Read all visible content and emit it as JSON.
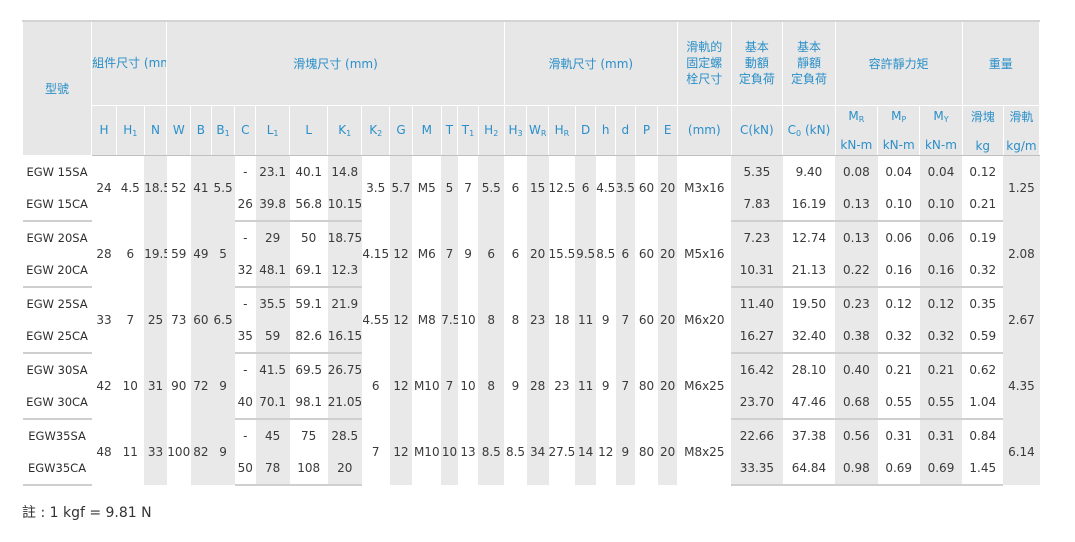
{
  "headers": {
    "model": "型號",
    "assembly": "組件尺寸 (mm)",
    "block": "滑塊尺寸 (mm)",
    "rail": "滑軌尺寸 (mm)",
    "bolt_l1": "滑軌的",
    "bolt_l2": "固定螺",
    "bolt_l3": "栓尺寸",
    "dyn_l1": "基本",
    "dyn_l2": "動額",
    "dyn_l3": "定負荷",
    "sta_l1": "基本",
    "sta_l2": "靜額",
    "sta_l3": "定負荷",
    "moment": "容許靜力矩",
    "weight": "重量",
    "block_w": "滑塊",
    "rail_w": "滑軌",
    "mm": "(mm)",
    "c_kn": "C(kN)",
    "c0_kn": "C",
    "c0_sub": "0",
    "c0_unit": " (kN)",
    "knm1": "kN-m",
    "knm2": "kN-m",
    "knm3": "kN-m",
    "kg": "kg",
    "kgm": "kg/m"
  },
  "subheaders": [
    {
      "t": "H",
      "s": ""
    },
    {
      "t": "H",
      "s": "1"
    },
    {
      "t": "N",
      "s": ""
    },
    {
      "t": "W",
      "s": ""
    },
    {
      "t": "B",
      "s": ""
    },
    {
      "t": "B",
      "s": "1"
    },
    {
      "t": "C",
      "s": ""
    },
    {
      "t": "L",
      "s": "1"
    },
    {
      "t": "L",
      "s": ""
    },
    {
      "t": "K",
      "s": "1"
    },
    {
      "t": "K",
      "s": "2"
    },
    {
      "t": "G",
      "s": ""
    },
    {
      "t": "M",
      "s": ""
    },
    {
      "t": "T",
      "s": ""
    },
    {
      "t": "T",
      "s": "1"
    },
    {
      "t": "H",
      "s": "2"
    },
    {
      "t": "H",
      "s": "3"
    },
    {
      "t": "W",
      "s": "R"
    },
    {
      "t": "H",
      "s": "R"
    },
    {
      "t": "D",
      "s": ""
    },
    {
      "t": "h",
      "s": ""
    },
    {
      "t": "d",
      "s": ""
    },
    {
      "t": "P",
      "s": ""
    },
    {
      "t": "E",
      "s": ""
    }
  ],
  "moments": [
    {
      "t": "M",
      "s": "R"
    },
    {
      "t": "M",
      "s": "P"
    },
    {
      "t": "M",
      "s": "Y"
    }
  ],
  "groups": [
    {
      "common": {
        "H": "24",
        "H1": "4.5",
        "N": "18.5",
        "W": "52",
        "B": "41",
        "B1": "5.5",
        "K2": "3.5",
        "G": "5.7",
        "M": "M5",
        "T": "5",
        "T1": "7",
        "H2": "5.5",
        "H3": "6",
        "WR": "15",
        "HR": "12.5",
        "D": "6",
        "h": "4.5",
        "d": "3.5",
        "P": "60",
        "E": "20",
        "bolt": "M3x16",
        "rail_w": "1.25"
      },
      "rows": [
        {
          "model": "EGW 15SA",
          "C": "-",
          "L1": "23.1",
          "L": "40.1",
          "K1": "14.8",
          "dyn": "5.35",
          "sta": "9.40",
          "MR": "0.08",
          "MP": "0.04",
          "MY": "0.04",
          "block_w": "0.12"
        },
        {
          "model": "EGW 15CA",
          "C": "26",
          "L1": "39.8",
          "L": "56.8",
          "K1": "10.15",
          "dyn": "7.83",
          "sta": "16.19",
          "MR": "0.13",
          "MP": "0.10",
          "MY": "0.10",
          "block_w": "0.21"
        }
      ]
    },
    {
      "common": {
        "H": "28",
        "H1": "6",
        "N": "19.5",
        "W": "59",
        "B": "49",
        "B1": "5",
        "K2": "4.15",
        "G": "12",
        "M": "M6",
        "T": "7",
        "T1": "9",
        "H2": "6",
        "H3": "6",
        "WR": "20",
        "HR": "15.5",
        "D": "9.5",
        "h": "8.5",
        "d": "6",
        "P": "60",
        "E": "20",
        "bolt": "M5x16",
        "rail_w": "2.08"
      },
      "rows": [
        {
          "model": "EGW 20SA",
          "C": "-",
          "L1": "29",
          "L": "50",
          "K1": "18.75",
          "dyn": "7.23",
          "sta": "12.74",
          "MR": "0.13",
          "MP": "0.06",
          "MY": "0.06",
          "block_w": "0.19"
        },
        {
          "model": "EGW 20CA",
          "C": "32",
          "L1": "48.1",
          "L": "69.1",
          "K1": "12.3",
          "dyn": "10.31",
          "sta": "21.13",
          "MR": "0.22",
          "MP": "0.16",
          "MY": "0.16",
          "block_w": "0.32"
        }
      ]
    },
    {
      "common": {
        "H": "33",
        "H1": "7",
        "N": "25",
        "W": "73",
        "B": "60",
        "B1": "6.5",
        "K2": "4.55",
        "G": "12",
        "M": "M8",
        "T": "7.5",
        "T1": "10",
        "H2": "8",
        "H3": "8",
        "WR": "23",
        "HR": "18",
        "D": "11",
        "h": "9",
        "d": "7",
        "P": "60",
        "E": "20",
        "bolt": "M6x20",
        "rail_w": "2.67"
      },
      "rows": [
        {
          "model": "EGW 25SA",
          "C": "-",
          "L1": "35.5",
          "L": "59.1",
          "K1": "21.9",
          "dyn": "11.40",
          "sta": "19.50",
          "MR": "0.23",
          "MP": "0.12",
          "MY": "0.12",
          "block_w": "0.35"
        },
        {
          "model": "EGW 25CA",
          "C": "35",
          "L1": "59",
          "L": "82.6",
          "K1": "16.15",
          "dyn": "16.27",
          "sta": "32.40",
          "MR": "0.38",
          "MP": "0.32",
          "MY": "0.32",
          "block_w": "0.59"
        }
      ]
    },
    {
      "common": {
        "H": "42",
        "H1": "10",
        "N": "31",
        "W": "90",
        "B": "72",
        "B1": "9",
        "K2": "6",
        "G": "12",
        "M": "M10",
        "T": "7",
        "T1": "10",
        "H2": "8",
        "H3": "9",
        "WR": "28",
        "HR": "23",
        "D": "11",
        "h": "9",
        "d": "7",
        "P": "80",
        "E": "20",
        "bolt": "M6x25",
        "rail_w": "4.35"
      },
      "rows": [
        {
          "model": "EGW 30SA",
          "C": "-",
          "L1": "41.5",
          "L": "69.5",
          "K1": "26.75",
          "dyn": "16.42",
          "sta": "28.10",
          "MR": "0.40",
          "MP": "0.21",
          "MY": "0.21",
          "block_w": "0.62"
        },
        {
          "model": "EGW 30CA",
          "C": "40",
          "L1": "70.1",
          "L": "98.1",
          "K1": "21.05",
          "dyn": "23.70",
          "sta": "47.46",
          "MR": "0.68",
          "MP": "0.55",
          "MY": "0.55",
          "block_w": "1.04"
        }
      ]
    },
    {
      "common": {
        "H": "48",
        "H1": "11",
        "N": "33",
        "W": "100",
        "B": "82",
        "B1": "9",
        "K2": "7",
        "G": "12",
        "M": "M10",
        "T": "10",
        "T1": "13",
        "H2": "8.5",
        "H3": "8.5",
        "WR": "34",
        "HR": "27.5",
        "D": "14",
        "h": "12",
        "d": "9",
        "P": "80",
        "E": "20",
        "bolt": "M8x25",
        "rail_w": "6.14"
      },
      "rows": [
        {
          "model": "EGW35SA",
          "C": "-",
          "L1": "45",
          "L": "75",
          "K1": "28.5",
          "dyn": "22.66",
          "sta": "37.38",
          "MR": "0.56",
          "MP": "0.31",
          "MY": "0.31",
          "block_w": "0.84"
        },
        {
          "model": "EGW35CA",
          "C": "50",
          "L1": "78",
          "L": "108",
          "K1": "20",
          "dyn": "33.35",
          "sta": "64.84",
          "MR": "0.98",
          "MP": "0.69",
          "MY": "0.69",
          "block_w": "1.45"
        }
      ]
    }
  ],
  "note": "註 : 1 kgf = 9.81 N",
  "colors": {
    "header_text": "#2a8fc9",
    "header_bg": "#e7e7e7",
    "row_shade": "#e9e9e9"
  }
}
